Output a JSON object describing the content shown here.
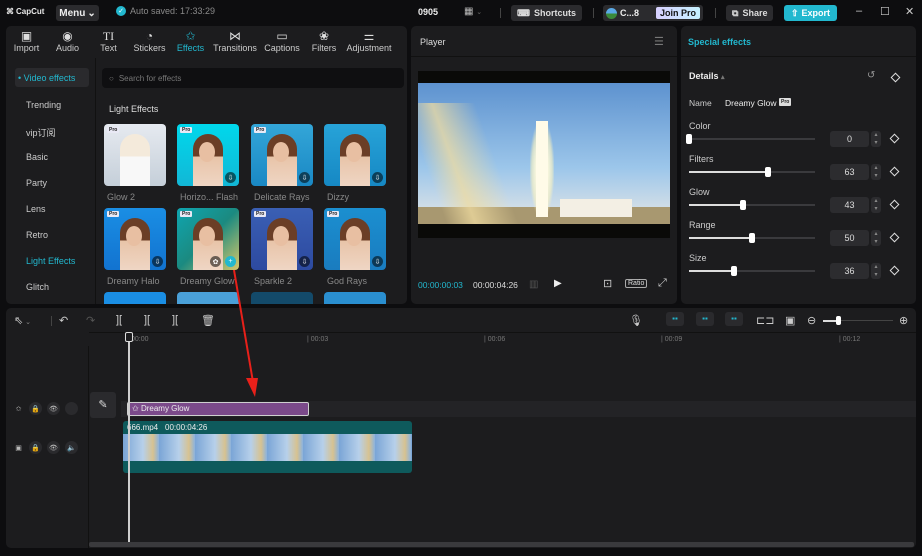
{
  "app": {
    "logo": "CapCut",
    "menu": "Menu",
    "autosave": "Auto saved: 17:33:29",
    "project": "0905",
    "shortcuts": "Shortcuts",
    "user": "C...8",
    "join_pro": "Join Pro",
    "share": "Share",
    "export": "Export"
  },
  "tabs": [
    {
      "label": "Import",
      "icon": "import-icon"
    },
    {
      "label": "Audio",
      "icon": "audio-icon"
    },
    {
      "label": "Text",
      "icon": "text-icon"
    },
    {
      "label": "Stickers",
      "icon": "sticker-icon"
    },
    {
      "label": "Effects",
      "icon": "effects-icon",
      "active": true
    },
    {
      "label": "Transitions",
      "icon": "transition-icon"
    },
    {
      "label": "Captions",
      "icon": "captions-icon"
    },
    {
      "label": "Filters",
      "icon": "filters-icon"
    },
    {
      "label": "Adjustment",
      "icon": "adjustment-icon"
    }
  ],
  "sidebar": {
    "category": "• Video effects",
    "items": [
      "Trending",
      "vip订阅",
      "Basic",
      "Party",
      "Lens",
      "Retro",
      "Light Effects",
      "Glitch"
    ],
    "active": "Light Effects"
  },
  "search": {
    "placeholder": "Search for effects"
  },
  "section_title": "Light Effects",
  "effects": [
    {
      "name": "Glow 2",
      "pro": "Pro"
    },
    {
      "name": "Horizo... Flash",
      "pro": "Pro"
    },
    {
      "name": "Delicate Rays",
      "pro": "Pro"
    },
    {
      "name": "Dizzy",
      "pro": ""
    },
    {
      "name": "Dreamy Halo",
      "pro": "Pro"
    },
    {
      "name": "Dreamy Glow",
      "pro": "Pro"
    },
    {
      "name": "Sparkle 2",
      "pro": "Pro"
    },
    {
      "name": "God Rays",
      "pro": "Pro"
    }
  ],
  "player": {
    "title": "Player",
    "current": "00:00:00:03",
    "total": "00:00:04:26",
    "ratio": "Ratio"
  },
  "special": {
    "title": "Special effects",
    "details": "Details",
    "name_label": "Name",
    "name_value": "Dreamy Glow",
    "pro": "Pro",
    "params": [
      {
        "label": "Color",
        "value": "0"
      },
      {
        "label": "Filters",
        "value": "63"
      },
      {
        "label": "Glow",
        "value": "43"
      },
      {
        "label": "Range",
        "value": "50"
      },
      {
        "label": "Size",
        "value": "36"
      }
    ]
  },
  "timeline": {
    "ticks": [
      "00:00",
      "| 00:03",
      "| 00:06",
      "| 00:09",
      "| 00:12"
    ],
    "fx_clip": "Dreamy Glow",
    "video_name": "666.mp4",
    "video_duration": "00:00:04:26"
  },
  "colors": {
    "accent": "#22b8cf",
    "fx_clip": "#7b4a8a",
    "video_clip": "#0e5a5c"
  }
}
